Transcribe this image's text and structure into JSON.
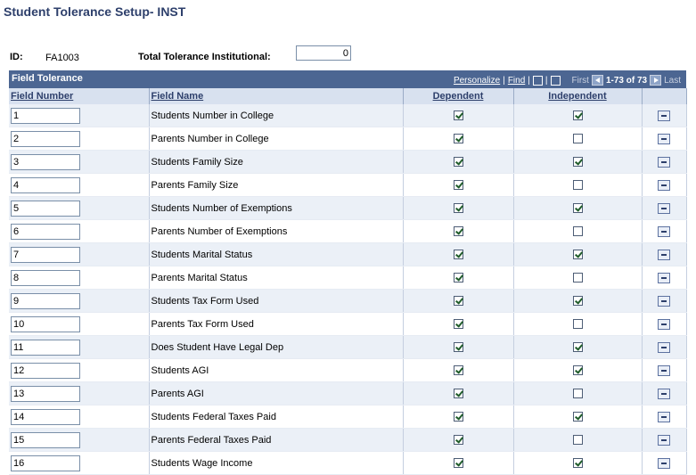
{
  "page": {
    "title": "Student Tolerance Setup- INST"
  },
  "header": {
    "id_label": "ID:",
    "id_value": "FA1003",
    "total_label": "Total Tolerance Institutional:",
    "total_value": "0"
  },
  "grid": {
    "title": "Field Tolerance",
    "nav": {
      "personalize": "Personalize",
      "find": "Find",
      "first": "First",
      "range": "1-73 of 73",
      "last": "Last"
    },
    "columns": {
      "field_number": "Field Number",
      "field_name": "Field Name",
      "dependent": "Dependent",
      "independent": "Independent"
    },
    "rows": [
      {
        "number": "1",
        "name": "Students Number in College",
        "dependent": true,
        "independent": true
      },
      {
        "number": "2",
        "name": "Parents Number in College",
        "dependent": true,
        "independent": false
      },
      {
        "number": "3",
        "name": "Students Family Size",
        "dependent": true,
        "independent": true
      },
      {
        "number": "4",
        "name": "Parents Family Size",
        "dependent": true,
        "independent": false
      },
      {
        "number": "5",
        "name": "Students Number of Exemptions",
        "dependent": true,
        "independent": true
      },
      {
        "number": "6",
        "name": "Parents Number of Exemptions",
        "dependent": true,
        "independent": false
      },
      {
        "number": "7",
        "name": "Students Marital Status",
        "dependent": true,
        "independent": true
      },
      {
        "number": "8",
        "name": "Parents Marital Status",
        "dependent": true,
        "independent": false
      },
      {
        "number": "9",
        "name": "Students Tax Form Used",
        "dependent": true,
        "independent": true
      },
      {
        "number": "10",
        "name": "Parents Tax Form Used",
        "dependent": true,
        "independent": false
      },
      {
        "number": "11",
        "name": "Does Student Have Legal Dep",
        "dependent": true,
        "independent": true
      },
      {
        "number": "12",
        "name": "Students AGI",
        "dependent": true,
        "independent": true
      },
      {
        "number": "13",
        "name": "Parents AGI",
        "dependent": true,
        "independent": false
      },
      {
        "number": "14",
        "name": "Students Federal Taxes Paid",
        "dependent": true,
        "independent": true
      },
      {
        "number": "15",
        "name": "Parents Federal Taxes Paid",
        "dependent": true,
        "independent": false
      },
      {
        "number": "16",
        "name": "Students Wage Income",
        "dependent": true,
        "independent": true
      }
    ]
  }
}
